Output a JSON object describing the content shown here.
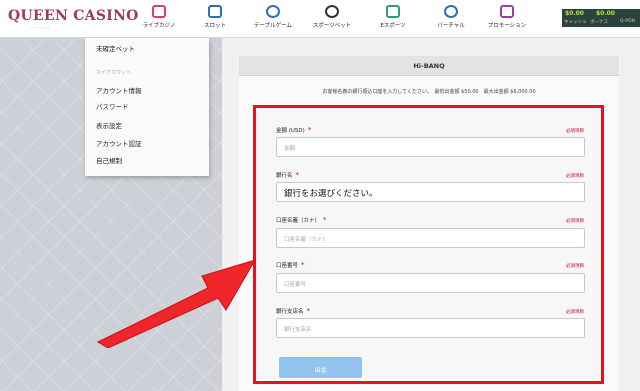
{
  "brand": {
    "logo_text": "QUEEN CASINO",
    "logo_sub": "· · · · · · · ·"
  },
  "nav": [
    {
      "label": "ライブカジノ",
      "icon": "live-casino-icon",
      "color": "#d9405a"
    },
    {
      "label": "スロット",
      "icon": "slot-icon",
      "color": "#2f6fb5"
    },
    {
      "label": "テーブルゲーム",
      "icon": "table-game-icon",
      "color": "#2f6fb5"
    },
    {
      "label": "スポーツベット",
      "icon": "sports-bet-icon",
      "color": "#333333"
    },
    {
      "label": "Eスポーツ",
      "icon": "esports-icon",
      "color": "#2f9e6f"
    },
    {
      "label": "バーチャル",
      "icon": "virtual-icon",
      "color": "#2f6fb5"
    },
    {
      "label": "プロモーション",
      "icon": "promotion-icon",
      "color": "#9b3ea8"
    }
  ],
  "wallet": {
    "cash_value": "$0.00",
    "cash_label": "キャッシュ",
    "bonus_value": "$0.00",
    "bonus_label": "ボーナス",
    "points_label": "Q-PON"
  },
  "menu": {
    "top_item": "未確定ベット",
    "section_heading": "マイアカウント",
    "items": [
      "アカウント情報",
      "パスワード",
      "表示設定",
      "アカウント認証",
      "自己規制"
    ]
  },
  "panel": {
    "title": "Hi-BANQ",
    "info": "お客様名義の銀行振込口座を入力してください。　最低出金額 $50.00　最大出金額 $6,000.00"
  },
  "form": {
    "required_label": "必須項目",
    "fields": [
      {
        "label": "金額 (USD)",
        "placeholder": "金額",
        "value": ""
      },
      {
        "label": "銀行名",
        "placeholder": "",
        "value": "銀行をお選びください。"
      },
      {
        "label": "口座名義（カナ）",
        "placeholder": "口座名義（カナ）",
        "value": ""
      },
      {
        "label": "口座番号",
        "placeholder": "口座番号",
        "value": ""
      },
      {
        "label": "銀行支店名",
        "placeholder": "銀行支店名",
        "value": ""
      }
    ],
    "submit_label": "出金"
  },
  "colors": {
    "highlight": "#e8121d",
    "submit": "#92c4ee",
    "brand": "#a23a4f"
  }
}
